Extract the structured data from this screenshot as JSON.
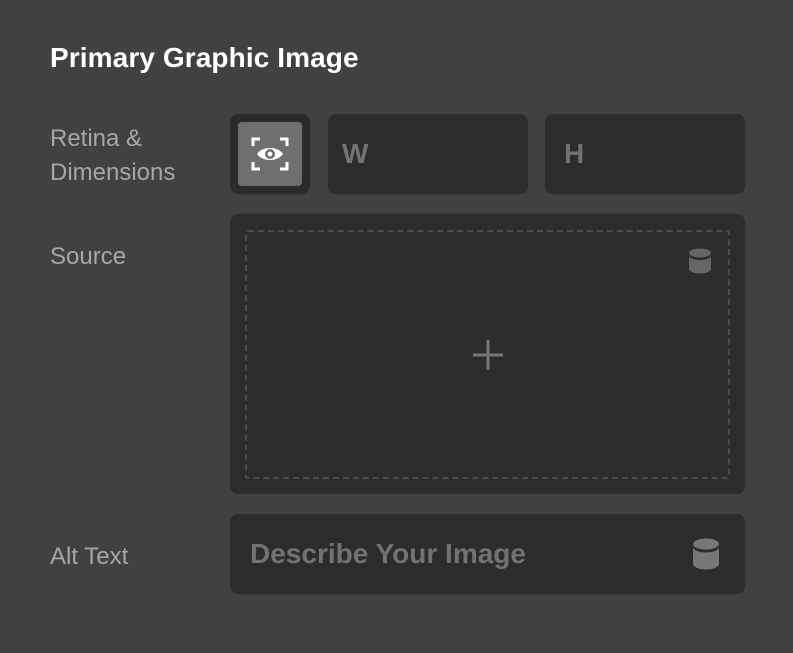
{
  "panel": {
    "title": "Primary Graphic Image"
  },
  "retina": {
    "label_line1": "Retina &",
    "label_line2": "Dimensions",
    "toggle_icon": "eye-scan-icon",
    "width_placeholder": "W",
    "height_placeholder": "H"
  },
  "source": {
    "label": "Source",
    "dynamic_data_icon": "database-icon",
    "add_icon": "plus-icon"
  },
  "alt_text": {
    "label": "Alt Text",
    "placeholder": "Describe Your Image",
    "dynamic_data_icon": "database-icon"
  },
  "colors": {
    "background": "#414141",
    "field": "#2c2c2c",
    "toggle_active": "#6f6f6f",
    "label": "#a7a7a7",
    "placeholder": "#727272",
    "title": "#ffffff"
  }
}
